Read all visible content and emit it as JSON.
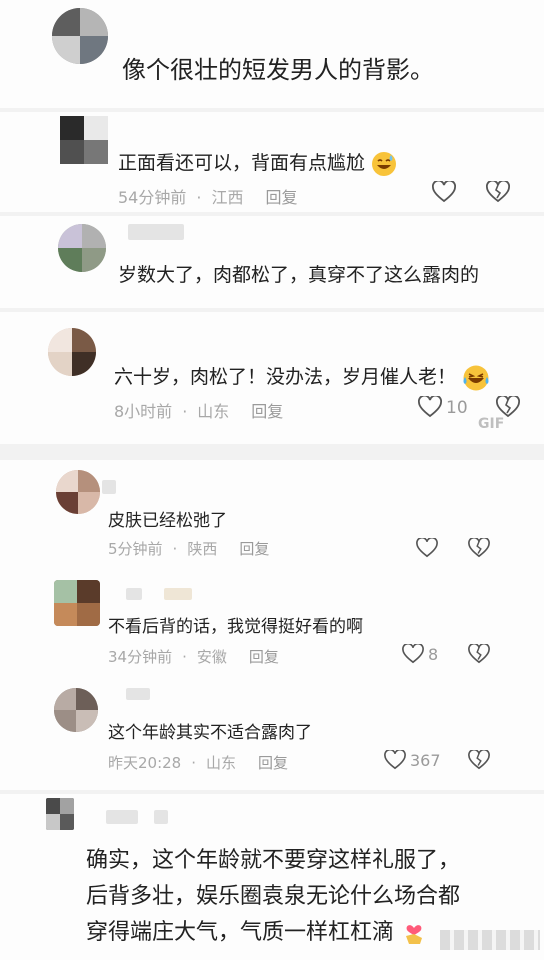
{
  "comments": [
    {
      "text": "像个很壮的短发男人的背影。"
    },
    {
      "text": "正面看还可以，背面有点尴尬",
      "time": "54分钟前",
      "location": "江西",
      "reply": "回复"
    },
    {
      "text": "岁数大了，肉都松了，真穿不了这么露肉的"
    },
    {
      "text": "六十岁，肉松了！没办法，岁月催人老！",
      "time": "8小时前",
      "location": "山东",
      "reply": "回复",
      "likes": "10",
      "gif": "GIF"
    },
    {
      "text": "皮肤已经松弛了",
      "time": "5分钟前",
      "location": "陕西",
      "reply": "回复"
    },
    {
      "text": "不看后背的话，我觉得挺好看的啊",
      "time": "34分钟前",
      "location": "安徽",
      "reply": "回复",
      "likes": "8"
    },
    {
      "text": "这个年龄其实不适合露肉了",
      "time": "昨天20:28",
      "location": "山东",
      "reply": "回复",
      "likes": "367"
    },
    {
      "lines": [
        "确实，这个年龄就不要穿这样礼服了，",
        "后背多壮，娱乐圈袁泉无论什么场合都",
        "穿得端庄大气，气质一样杠杠滴"
      ]
    }
  ],
  "separator": "·",
  "icons": {
    "like": "heart-outline-icon",
    "dislike": "broken-heart-icon",
    "laugh": "laughing-tears-emoji",
    "sweat": "sweat-smile-emoji",
    "hand": "hand-heart-emoji"
  }
}
